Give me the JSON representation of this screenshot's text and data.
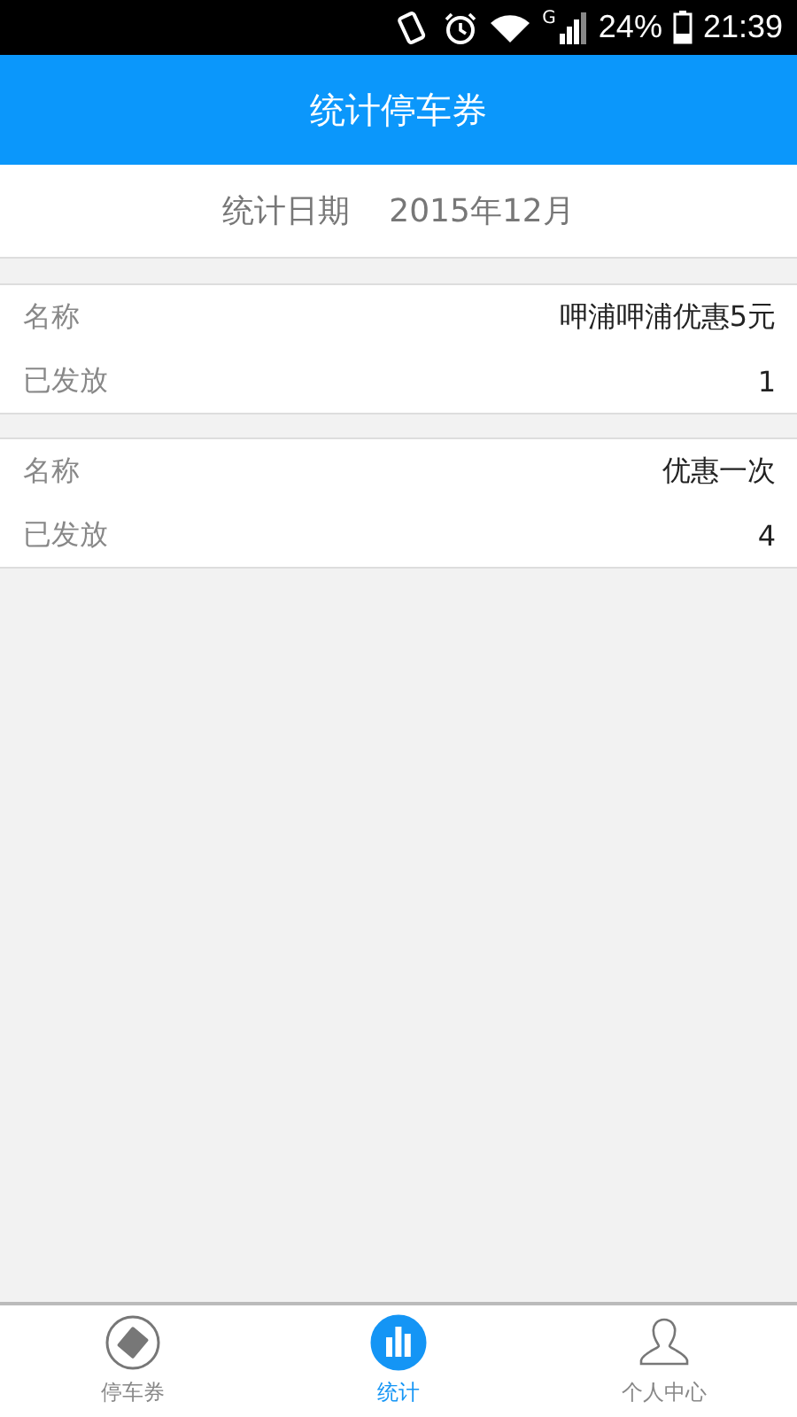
{
  "status_bar": {
    "network": "G",
    "battery": "24%",
    "time": "21:39"
  },
  "header": {
    "title": "统计停车券"
  },
  "date_row": {
    "label": "统计日期",
    "value": "2015年12月"
  },
  "records": [
    {
      "fields": [
        {
          "label": "名称",
          "value": "呷浦呷浦优惠5元"
        },
        {
          "label": "已发放",
          "value": "1"
        }
      ]
    },
    {
      "fields": [
        {
          "label": "名称",
          "value": "优惠一次"
        },
        {
          "label": "已发放",
          "value": "4"
        }
      ]
    }
  ],
  "tabs": [
    {
      "kind": "ticket",
      "label": "停车券",
      "selected": false
    },
    {
      "kind": "chart",
      "label": "统计",
      "selected": true
    },
    {
      "kind": "person",
      "label": "个人中心",
      "selected": false
    }
  ]
}
